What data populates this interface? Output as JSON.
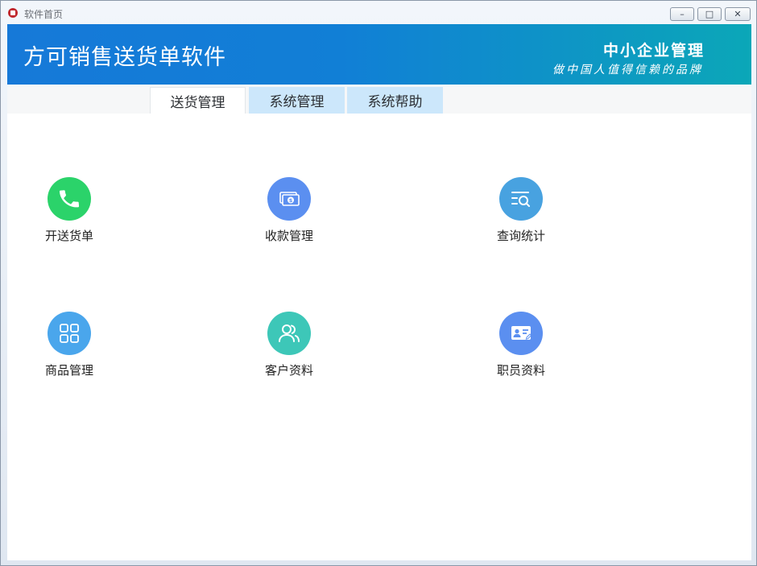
{
  "window": {
    "title": "软件首页",
    "buttons": {
      "minimize": "–",
      "maximize": "□",
      "close": "✕"
    }
  },
  "banner": {
    "app_title": "方可销售送货单软件",
    "slogan_line1": "中小企业管理",
    "slogan_line2": "做中国人值得信赖的品牌"
  },
  "tabs": [
    {
      "label": "送货管理",
      "active": true
    },
    {
      "label": "系统管理",
      "active": false
    },
    {
      "label": "系统帮助",
      "active": false
    }
  ],
  "tiles": [
    {
      "label": "开送货单",
      "icon": "phone-icon",
      "color": "#2bd36a"
    },
    {
      "label": "收款管理",
      "icon": "money-icon",
      "color": "#5b8ff0"
    },
    {
      "label": "查询统计",
      "icon": "search-list-icon",
      "color": "#48a2e0"
    },
    {
      "label": "商品管理",
      "icon": "grid-icon",
      "color": "#4aa6ec"
    },
    {
      "label": "客户资料",
      "icon": "users-icon",
      "color": "#3dc7b8"
    },
    {
      "label": "职员资料",
      "icon": "id-card-icon",
      "color": "#5b8ff0"
    }
  ],
  "colors": {
    "banner_start": "#1679d8",
    "banner_end": "#0ba7b8",
    "tab_inactive": "#cce7fb"
  }
}
